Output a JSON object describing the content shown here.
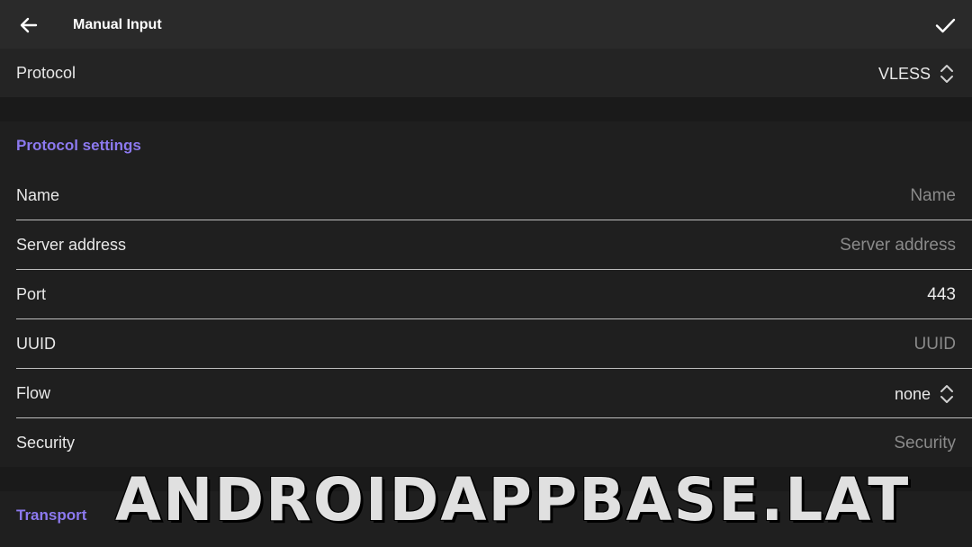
{
  "appbar": {
    "title": "Manual Input",
    "back_icon": "arrow-left-icon",
    "confirm_icon": "check-icon"
  },
  "protocol_row": {
    "label": "Protocol",
    "value": "VLESS"
  },
  "sections": {
    "protocol_settings": "Protocol settings",
    "transport": "Transport"
  },
  "fields": {
    "name": {
      "label": "Name",
      "placeholder": "Name"
    },
    "server_address": {
      "label": "Server address",
      "placeholder": "Server address"
    },
    "port": {
      "label": "Port",
      "value": "443"
    },
    "uuid": {
      "label": "UUID",
      "placeholder": "UUID"
    },
    "flow": {
      "label": "Flow",
      "value": "none"
    },
    "security": {
      "label": "Security",
      "placeholder": "Security"
    }
  },
  "watermark": "ANDROIDAPPBASE.LAT",
  "colors": {
    "accent": "#8c79ef",
    "background": "#1f1f1f",
    "appbar": "#2a2a2a"
  }
}
